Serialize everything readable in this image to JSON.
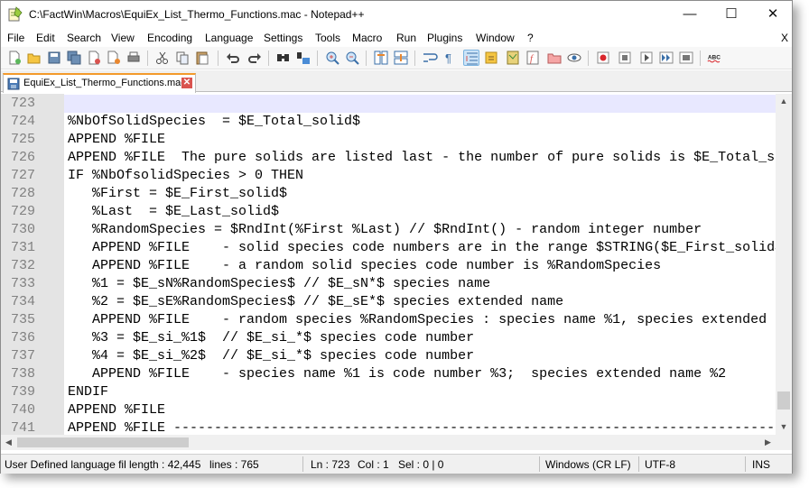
{
  "window": {
    "title": "C:\\FactWin\\Macros\\EquiEx_List_Thermo_Functions.mac - Notepad++",
    "min_glyph": "—",
    "max_glyph": "☐",
    "close_glyph": "✕"
  },
  "menu": {
    "items": [
      "File",
      "Edit",
      "Search",
      "View",
      "Encoding",
      "Language",
      "Settings",
      "Tools",
      "Macro",
      "Run",
      "Plugins",
      "Window",
      "?"
    ],
    "close_label": "X"
  },
  "toolbar": {
    "buttons": [
      "new-file-icon",
      "open-file-icon",
      "save-icon",
      "save-all-icon",
      "close-icon",
      "close-all-icon",
      "print-icon",
      "cut-icon",
      "copy-icon",
      "paste-icon",
      "undo-icon",
      "redo-icon",
      "find-icon",
      "replace-icon",
      "zoom-in-icon",
      "zoom-out-icon",
      "sync-vertical-icon",
      "sync-horizontal-icon",
      "word-wrap-icon",
      "show-all-characters-icon",
      "indent-guide-icon",
      "user-defined-language-icon",
      "document-map-icon",
      "function-list-icon",
      "folder-as-workspace-icon",
      "monitoring-icon",
      "record-macro-icon",
      "stop-recording-icon",
      "playback-macro-icon",
      "run-macro-multiple-icon",
      "save-macro-icon",
      "spell-check-icon"
    ],
    "spell_check_label": "ABC"
  },
  "tab": {
    "label": "EquiEx_List_Thermo_Functions.mac",
    "close_glyph": "✕"
  },
  "editor": {
    "current_line": 723,
    "lines": [
      {
        "num": "723",
        "text": ""
      },
      {
        "num": "724",
        "text": "%NbOfSolidSpecies  = $E_Total_solid$"
      },
      {
        "num": "725",
        "text": "APPEND %FILE"
      },
      {
        "num": "726",
        "text": "APPEND %FILE  The pure solids are listed last - the number of pure solids is $E_Total_solid$"
      },
      {
        "num": "727",
        "text": "IF %NbOfsolidSpecies > 0 THEN"
      },
      {
        "num": "728",
        "text": "   %First = $E_First_solid$"
      },
      {
        "num": "729",
        "text": "   %Last  = $E_Last_solid$"
      },
      {
        "num": "730",
        "text": "   %RandomSpecies = $RndInt(%First %Last) // $RndInt() - random integer number"
      },
      {
        "num": "731",
        "text": "   APPEND %FILE    - solid species code numbers are in the range $STRING($E_First_solid$)"
      },
      {
        "num": "732",
        "text": "   APPEND %FILE    - a random solid species code number is %RandomSpecies"
      },
      {
        "num": "733",
        "text": "   %1 = $E_sN%RandomSpecies$ // $E_sN*$ species name"
      },
      {
        "num": "734",
        "text": "   %2 = $E_sE%RandomSpecies$ // $E_sE*$ species extended name"
      },
      {
        "num": "735",
        "text": "   APPEND %FILE    - random species %RandomSpecies : species name %1, species extended"
      },
      {
        "num": "736",
        "text": "   %3 = $E_si_%1$  // $E_si_*$ species code number"
      },
      {
        "num": "737",
        "text": "   %4 = $E_si_%2$  // $E_si_*$ species code number"
      },
      {
        "num": "738",
        "text": "   APPEND %FILE    - species name %1 is code number %3;  species extended name %2"
      },
      {
        "num": "739",
        "text": "ENDIF"
      },
      {
        "num": "740",
        "text": "APPEND %FILE"
      },
      {
        "num": "741",
        "text": "APPEND %FILE ----------------------------------------------------------------------------"
      }
    ]
  },
  "scrollbars": {
    "up_glyph": "▲",
    "down_glyph": "▼",
    "left_glyph": "◀",
    "right_glyph": "▶"
  },
  "status": {
    "language": "User Defined language file - Nb",
    "length": "length : 42,445",
    "lines": "lines : 765",
    "ln": "Ln : 723",
    "col": "Col : 1",
    "sel": "Sel : 0 | 0",
    "eol": "Windows (CR LF)",
    "encoding": "UTF-8",
    "mode": "INS"
  },
  "colors": {
    "gutter_bg": "#e4e4e4",
    "line_number": "#808080",
    "current_line_bg": "#e8e8ff",
    "tab_accent": "#f39a2b",
    "tab_close": "#d9534f"
  }
}
